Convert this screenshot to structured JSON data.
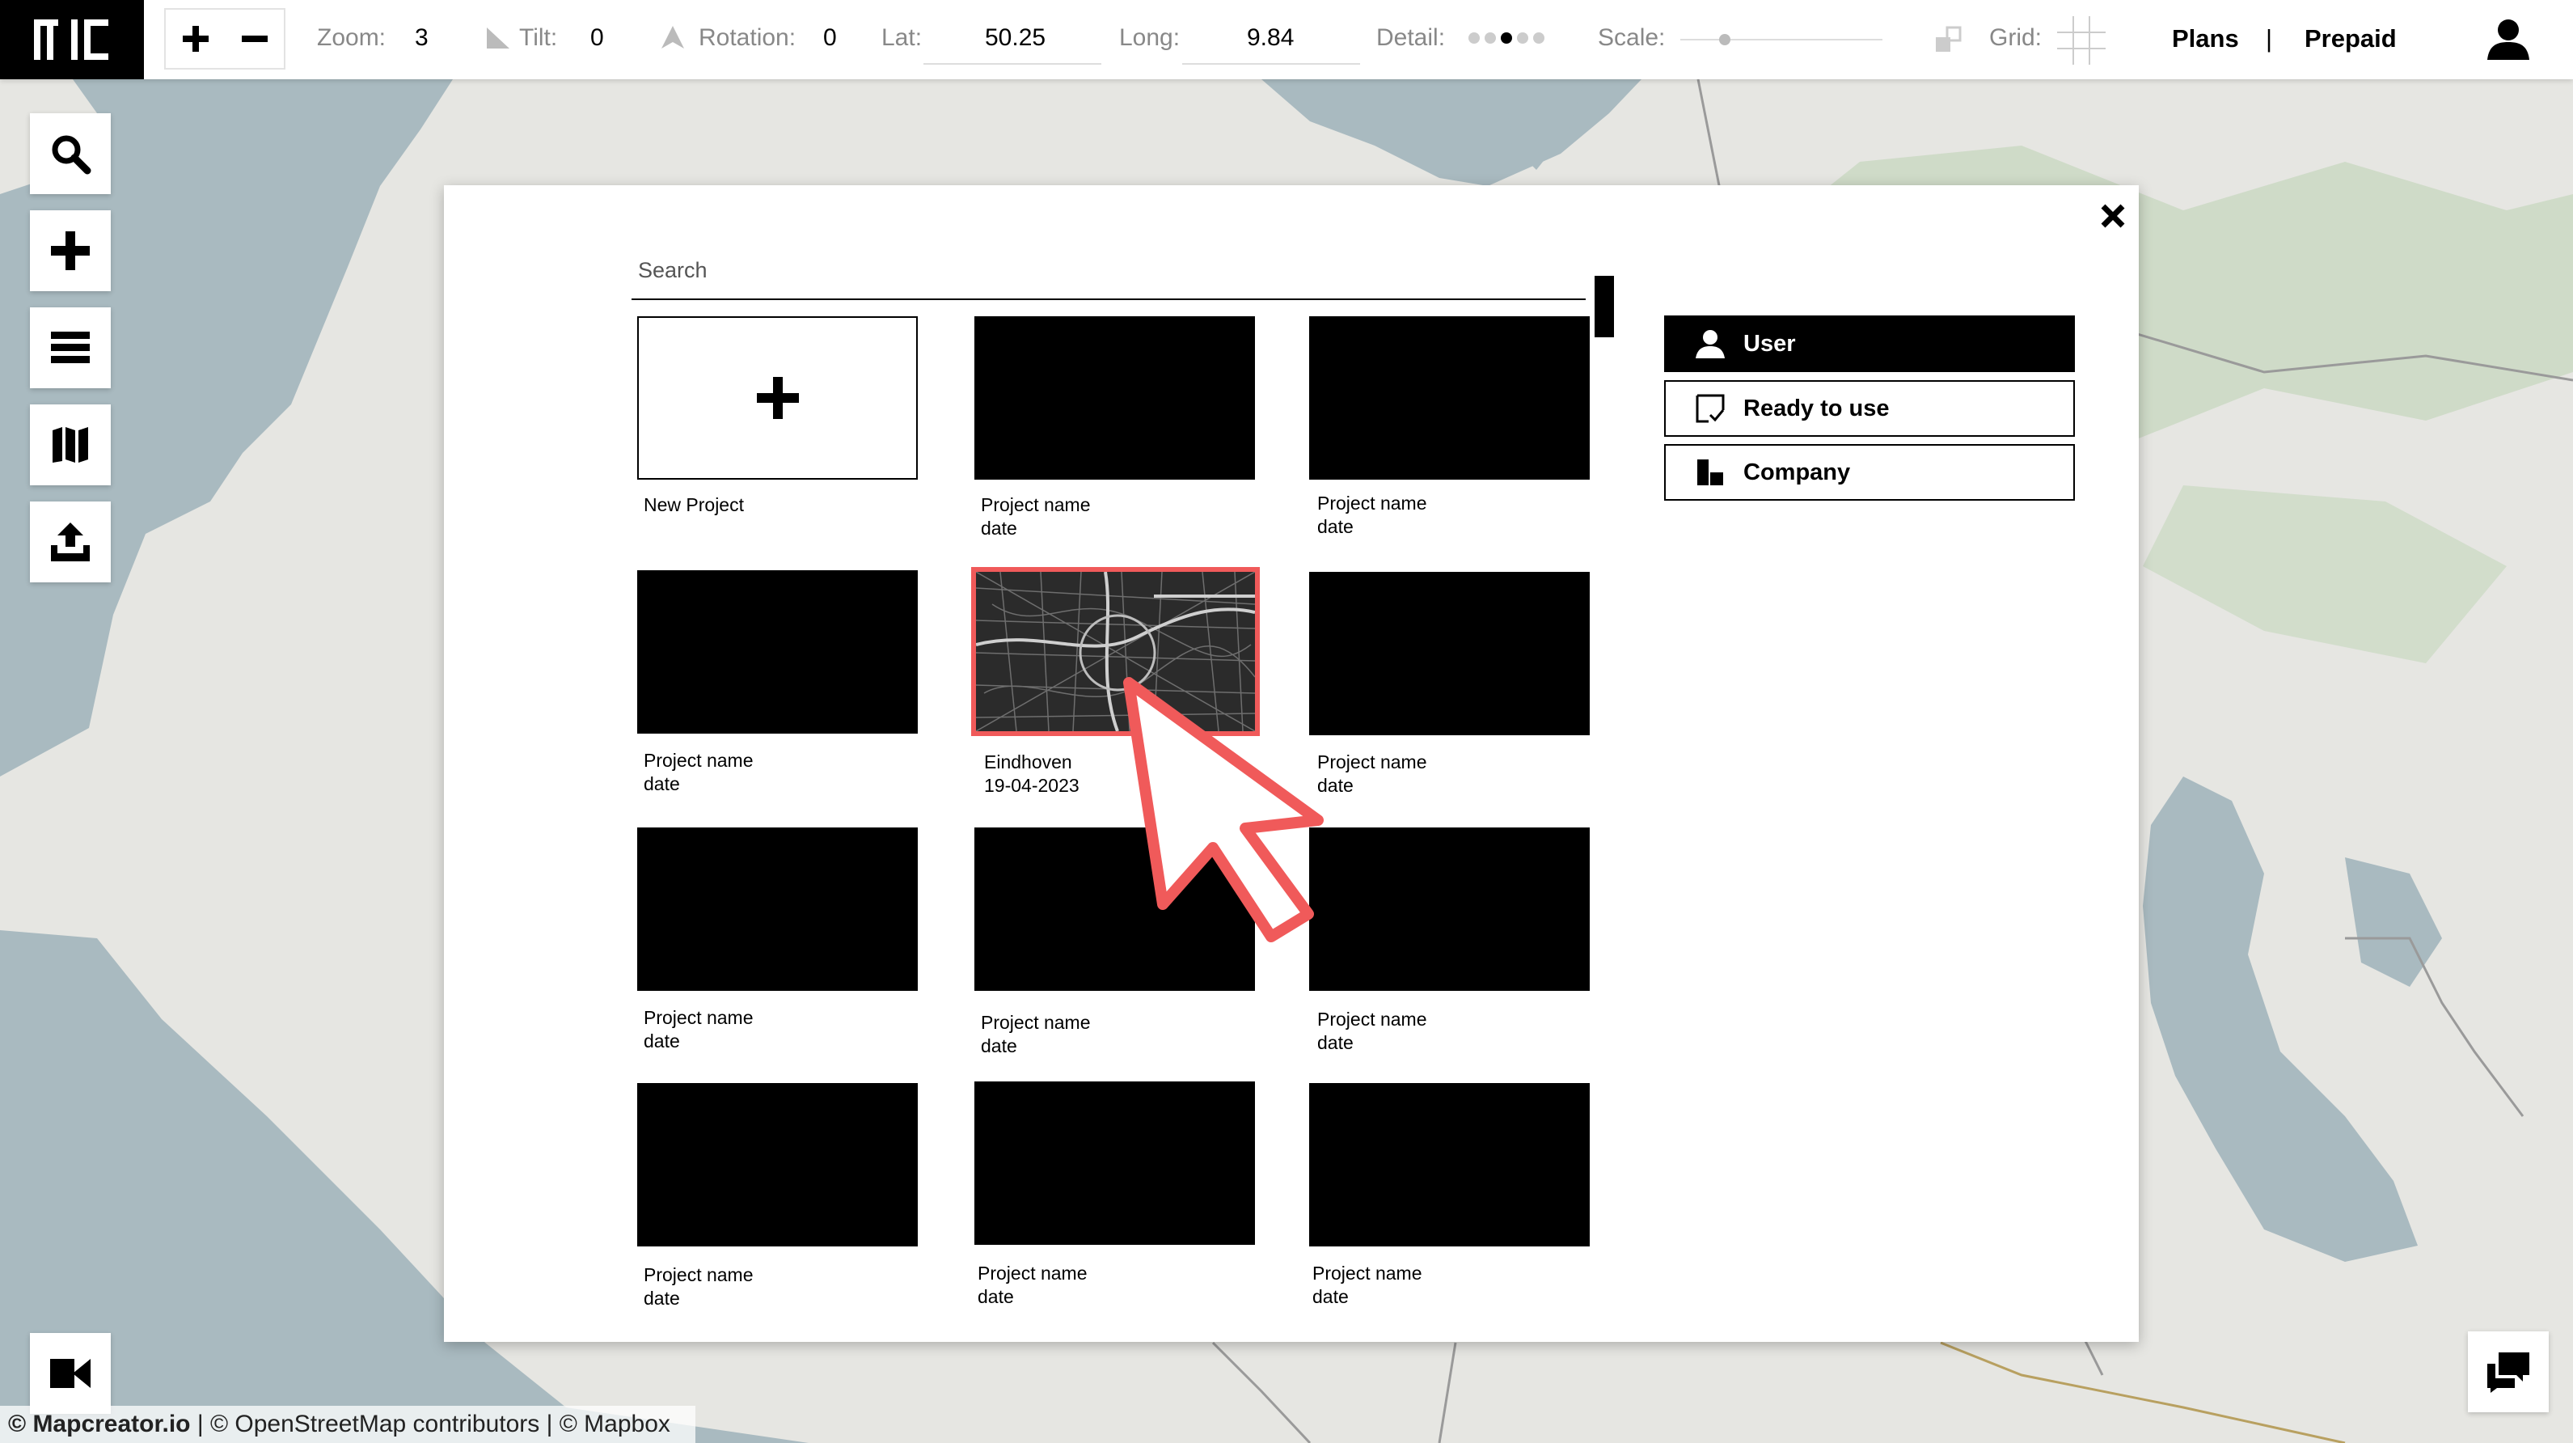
{
  "topbar": {
    "zoom_label": "Zoom:",
    "zoom_value": "3",
    "tilt_label": "Tilt:",
    "tilt_value": "0",
    "rotation_label": "Rotation:",
    "rotation_value": "0",
    "lat_label": "Lat:",
    "lat_value": "50.25",
    "long_label": "Long:",
    "long_value": "9.84",
    "detail_label": "Detail:",
    "detail_level": 3,
    "detail_max": 5,
    "scale_label": "Scale:",
    "grid_label": "Grid:",
    "plans_label": "Plans",
    "separator": "|",
    "prepaid_label": "Prepaid"
  },
  "attribution": {
    "brand": "© Mapcreator.io",
    "rest": " | © OpenStreetMap contributors | © Mapbox"
  },
  "modal": {
    "search_placeholder": "Search",
    "new_project_label": "New Project",
    "projects": [
      {
        "name": "Project name",
        "date": "date"
      },
      {
        "name": "Project name",
        "date": "date"
      },
      {
        "name": "Project name",
        "date": "date"
      },
      {
        "name": "Eindhoven",
        "date": "19-04-2023"
      },
      {
        "name": "Project name",
        "date": "date"
      },
      {
        "name": "Project name",
        "date": "date"
      },
      {
        "name": "Project name",
        "date": "date"
      },
      {
        "name": "Project name",
        "date": "date"
      },
      {
        "name": "Project name",
        "date": "date"
      },
      {
        "name": "Project name",
        "date": "date"
      },
      {
        "name": "Project name",
        "date": "date"
      }
    ],
    "filters": [
      {
        "label": "User",
        "icon": "user-icon",
        "active": true
      },
      {
        "label": "Ready to use",
        "icon": "ready-check-icon",
        "active": false
      },
      {
        "label": "Company",
        "icon": "company-icon",
        "active": false
      }
    ]
  },
  "colors": {
    "highlight": "#f05a5a",
    "map_water": "#a9bac0",
    "map_land": "#e6e6e2",
    "map_forest": "#c9d8c2"
  }
}
